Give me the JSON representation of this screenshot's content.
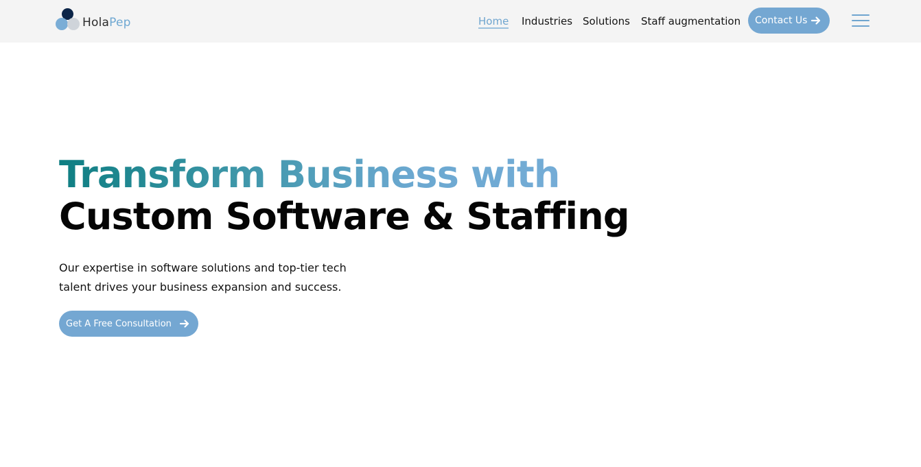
{
  "brand": {
    "name_part1": "Hola",
    "name_part2": "Pep",
    "colors": {
      "dark_navy": "#0c2548",
      "light_blue": "#7aadd6",
      "light_gray": "#cfd4da"
    }
  },
  "nav": {
    "items": [
      {
        "label": "Home",
        "active": true
      },
      {
        "label": "Industries",
        "active": false
      },
      {
        "label": "Solutions",
        "active": false
      },
      {
        "label": "Staff augmentation",
        "active": false
      }
    ],
    "contact_label": "Contact Us",
    "contact_icon": "arrow-right-icon",
    "menu_icon": "hamburger-menu-icon"
  },
  "hero": {
    "title_line1": "Transform Business with",
    "title_line2": "Custom Software & Staffing",
    "subtitle": "Our expertise in software solutions and top-tier tech talent drives your business expansion and success.",
    "cta_label": "Get A Free Consultation",
    "cta_icon": "arrow-right-icon"
  },
  "colors": {
    "accent": "#74a7d2",
    "header_bg": "#f4f4f4",
    "heading_gradient_start": "#0e7e82",
    "heading_gradient_end": "#74acd6"
  }
}
